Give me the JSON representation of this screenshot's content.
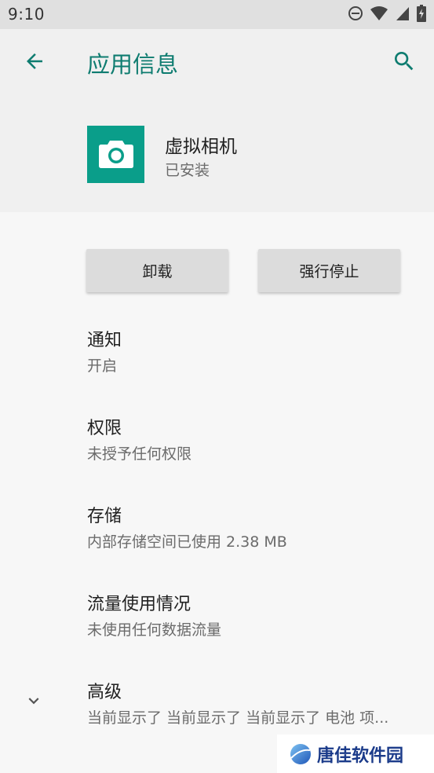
{
  "status_bar": {
    "time": "9:10",
    "icons": [
      "do-not-disturb-icon",
      "wifi-icon",
      "cell-signal-icon",
      "battery-icon"
    ]
  },
  "toolbar": {
    "title": "应用信息",
    "back_icon": "arrow-back-icon",
    "search_icon": "search-icon"
  },
  "app": {
    "name": "虚拟相机",
    "status": "已安装",
    "icon": "camera-icon",
    "icon_color": "#0a9e8a"
  },
  "actions": {
    "uninstall_label": "卸载",
    "force_stop_label": "强行停止"
  },
  "preferences": [
    {
      "title": "通知",
      "summary": "开启"
    },
    {
      "title": "权限",
      "summary": "未授予任何权限"
    },
    {
      "title": "存储",
      "summary": "内部存储空间已使用 2.38 MB"
    },
    {
      "title": "流量使用情况",
      "summary": "未使用任何数据流量"
    },
    {
      "title": "高级",
      "summary": "当前显示了 当前显示了 当前显示了 电池 项..."
    }
  ],
  "watermark": {
    "text": "唐佳软件园"
  },
  "colors": {
    "accent": "#0e7c70",
    "status_bar_bg": "#e0e0e0",
    "header_bg": "#f0f0f0",
    "page_bg": "#f7f7f7",
    "button_bg": "#dcdcdc"
  }
}
